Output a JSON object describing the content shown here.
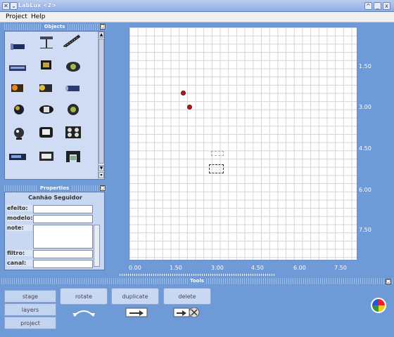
{
  "window": {
    "title": "LabLux <2>",
    "title_buttons": [
      "^",
      "_",
      "x"
    ]
  },
  "menu": [
    "Project",
    "Help"
  ],
  "objects_panel": {
    "header": "Objects",
    "items": [
      "spotlight",
      "light-tree",
      "led-bar",
      "strip-light",
      "scanner",
      "moving-head",
      "fresnel-orange",
      "fresnel-dark",
      "barrel-light",
      "par-can",
      "beam-light",
      "orb-light",
      "mirror-ball",
      "blinder",
      "four-pack-blinder",
      "wash-bar",
      "flood-light",
      "moving-yoke"
    ]
  },
  "properties_panel": {
    "header": "Properties",
    "title": "Canhão Seguidor",
    "fields": [
      {
        "label": "efeito:",
        "value": ""
      },
      {
        "label": "modelo:",
        "value": ""
      },
      {
        "label": "note:",
        "value": ""
      },
      {
        "label": "filtro:",
        "value": ""
      },
      {
        "label": "canal:",
        "value": ""
      }
    ]
  },
  "grid": {
    "y_labels": [
      "1.50",
      "3.00",
      "4.50",
      "6.00",
      "7.50"
    ],
    "x_labels": [
      "0.00",
      "1.50",
      "3.00",
      "4.50",
      "6.00",
      "7.50"
    ],
    "points": [
      {
        "x": 2.0,
        "y": 2.3
      },
      {
        "x": 2.2,
        "y": 2.8
      }
    ]
  },
  "tools": {
    "header": "Tools",
    "tabs": [
      "stage",
      "layers",
      "project"
    ],
    "buttons": [
      {
        "label": "rotate",
        "icon": "rotate-icon"
      },
      {
        "label": "duplicate",
        "icon": "duplicate-icon"
      },
      {
        "label": "delete",
        "icon": "delete-icon"
      }
    ]
  },
  "color_icon": "color-wheel-icon"
}
